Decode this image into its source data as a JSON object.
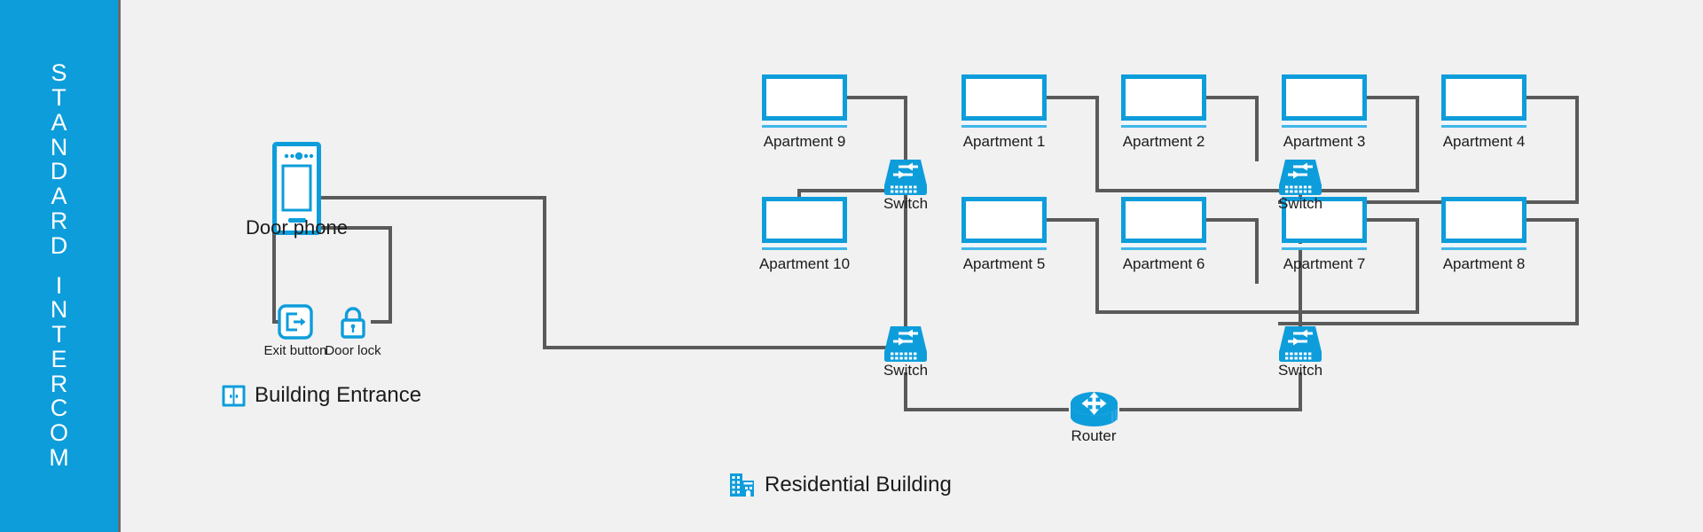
{
  "banner": {
    "line1": "STANDARD",
    "line2": "INTERCOM",
    "background": "#0d9ddb",
    "text_color": "#ffffff"
  },
  "theme": {
    "accent": "#0d9ddb",
    "accent_light": "#3fb7e8",
    "wire": "#5a5a5a",
    "background": "#f1f1f1",
    "text": "#1b1b1b"
  },
  "zones": [
    {
      "id": "building-entrance",
      "label": "Building Entrance",
      "icon": "double-door-icon"
    },
    {
      "id": "residential-building",
      "label": "Residential Building",
      "icon": "building-icon"
    }
  ],
  "entrance": {
    "door_phone": {
      "label": "Door phone",
      "icon": "door-phone-icon"
    },
    "exit_button": {
      "label": "Exit button",
      "icon": "exit-button-icon"
    },
    "door_lock": {
      "label": "Door lock",
      "icon": "padlock-icon"
    }
  },
  "network": {
    "switches": [
      {
        "id": "switch-top-left",
        "label": "Switch",
        "icon": "switch-icon"
      },
      {
        "id": "switch-bottom-left",
        "label": "Switch",
        "icon": "switch-icon"
      },
      {
        "id": "switch-top-right",
        "label": "Switch",
        "icon": "switch-icon"
      },
      {
        "id": "switch-bottom-right",
        "label": "Switch",
        "icon": "switch-icon"
      }
    ],
    "router": {
      "id": "router",
      "label": "Router",
      "icon": "router-icon"
    },
    "apartments": [
      {
        "id": "apartment-9",
        "label": "Apartment 9"
      },
      {
        "id": "apartment-1",
        "label": "Apartment 1"
      },
      {
        "id": "apartment-2",
        "label": "Apartment 2"
      },
      {
        "id": "apartment-3",
        "label": "Apartment 3"
      },
      {
        "id": "apartment-4",
        "label": "Apartment 4"
      },
      {
        "id": "apartment-10",
        "label": "Apartment 10"
      },
      {
        "id": "apartment-5",
        "label": "Apartment 5"
      },
      {
        "id": "apartment-6",
        "label": "Apartment 6"
      },
      {
        "id": "apartment-7",
        "label": "Apartment 7"
      },
      {
        "id": "apartment-8",
        "label": "Apartment 8"
      }
    ]
  }
}
